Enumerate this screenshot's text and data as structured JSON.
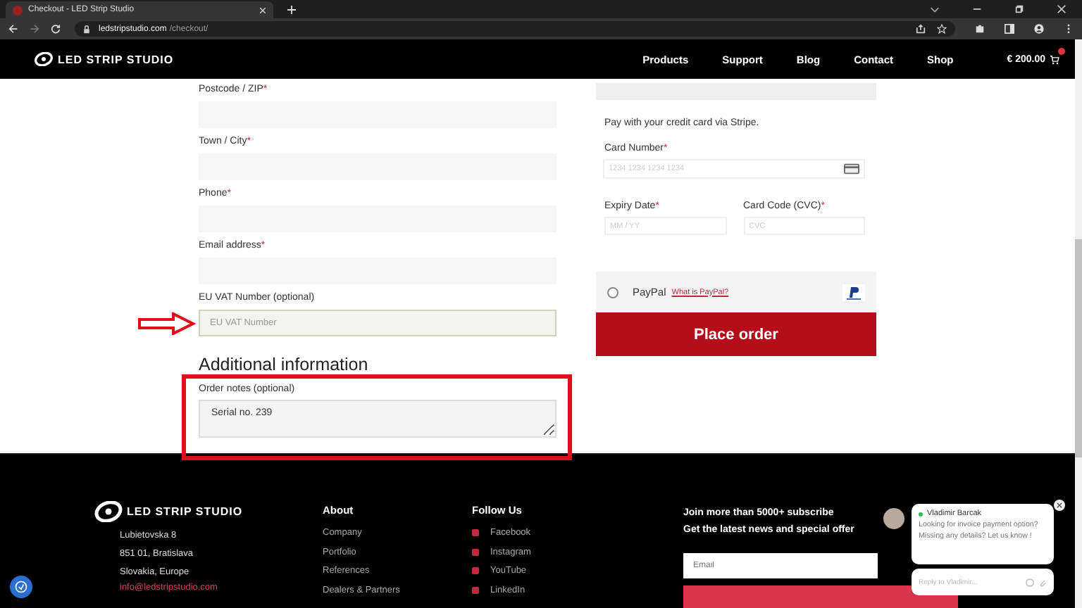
{
  "browser": {
    "tab_title": "Checkout - LED Strip Studio",
    "url_host": "ledstripstudio.com",
    "url_path": "/checkout/"
  },
  "header": {
    "logo": "LED STRIP STUDIO",
    "nav": [
      "Products",
      "Support",
      "Blog",
      "Contact",
      "Shop"
    ],
    "cart_total": "€ 200.00"
  },
  "billing_fields": [
    {
      "label": "Postcode / ZIP",
      "mark": "*",
      "focused": false
    },
    {
      "label": "Town / City",
      "mark": "*",
      "focused": false
    },
    {
      "label": "Phone",
      "mark": "*",
      "focused": false
    },
    {
      "label": "Email address",
      "mark": "*",
      "focused": false
    },
    {
      "label": "EU VAT Number (optional)",
      "placeholder": "EU VAT Number",
      "focused": true
    }
  ],
  "additional": {
    "heading": "Additional information",
    "notes_label": "Order notes (optional)",
    "notes_value": "Serial no. 239"
  },
  "payment": {
    "stripe_text": "Pay with your credit card via Stripe.",
    "card_number": {
      "label": "Card Number",
      "mark": "*",
      "placeholder": "1234 1234 1234 1234"
    },
    "expiry": {
      "label": "Expiry Date",
      "mark": "*",
      "placeholder": "MM / YY"
    },
    "cvc": {
      "label": "Card Code (CVC)",
      "mark": "*",
      "placeholder": "CVC"
    },
    "paypal": {
      "label": "PayPal",
      "link": "What is PayPal?",
      "selected": false
    },
    "place_order": "Place order"
  },
  "footer": {
    "logo": "LED STRIP STUDIO",
    "address": [
      "Lubietovska 8",
      "851 01, Bratislava",
      "Slovakia, Europe"
    ],
    "email": "info@ledstripstudio.com",
    "about": {
      "heading": "About",
      "links": [
        "Company",
        "Portfolio",
        "References",
        "Dealers & Partners"
      ]
    },
    "follow": {
      "heading": "Follow Us",
      "links": [
        "Facebook",
        "Instagram",
        "YouTube",
        "LinkedIn"
      ]
    },
    "newsletter": {
      "lines": [
        "Join more than 5000+ subscribe",
        "Get the latest news and special offer"
      ],
      "email_placeholder": "Email"
    }
  },
  "chat": {
    "agent": "Vladimir Barcak",
    "online": true,
    "message": "Looking for invoice payment option? Missing any details? Let us know !",
    "reply_placeholder": "Reply to Vladimir..."
  }
}
